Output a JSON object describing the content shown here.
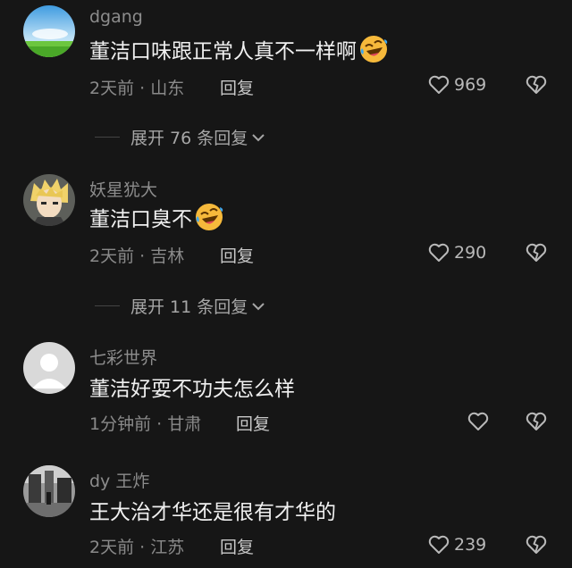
{
  "comments": [
    {
      "username": "dgang",
      "text": "董洁口味跟正常人真不一样啊",
      "emoji": "rofl-emoji",
      "meta": "2天前 · 山东",
      "reply_label": "回复",
      "likes": "969",
      "expand_label": "展开 76 条回复"
    },
    {
      "username": "妖星犹大",
      "text": "董洁口臭不",
      "emoji": "rofl-emoji",
      "meta": "2天前 · 吉林",
      "reply_label": "回复",
      "likes": "290",
      "expand_label": "展开 11 条回复"
    },
    {
      "username": "七彩世界",
      "text": "董洁好耍不功夫怎么样",
      "meta": "1分钟前 · 甘肃",
      "reply_label": "回复",
      "likes": ""
    },
    {
      "username": "dy 王炸",
      "text": "王大治才华还是很有才华的",
      "meta": "2天前 · 江苏",
      "reply_label": "回复",
      "likes": "239"
    }
  ],
  "colors": {
    "background": "#161616",
    "username": "#8c8c8c",
    "text": "#f0f0f0",
    "meta": "#8a8a8a"
  }
}
